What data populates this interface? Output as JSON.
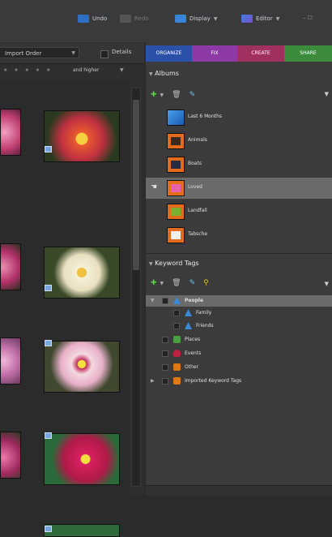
{
  "toolbar": {
    "undo_label": "Undo",
    "redo_label": "Redo",
    "display_label": "Display",
    "editor_label": "Editor",
    "edge_glyph": "– ☐"
  },
  "sort": {
    "selected": "Import Order",
    "details_label": "Details"
  },
  "rating": {
    "stars": "★ ★ ★ ★ ★",
    "and_higher": "and higher"
  },
  "tabs": [
    {
      "label": "ORGANIZE",
      "color": "#2b50a8"
    },
    {
      "label": "FIX",
      "color": "#8d39a6"
    },
    {
      "label": "CREATE",
      "color": "#a03060"
    },
    {
      "label": "SHARE",
      "color": "#3c8b3c"
    }
  ],
  "albums": {
    "title": "Albums",
    "items": [
      {
        "label": "Last 6 Months",
        "color": "#2a7fd6"
      },
      {
        "label": "Animals",
        "color": "#e36b1c"
      },
      {
        "label": "Boats",
        "color": "#e36b1c"
      },
      {
        "label": "Loved",
        "color": "#e36b1c"
      },
      {
        "label": "Landfall",
        "color": "#e36b1c"
      },
      {
        "label": "Tabsche",
        "color": "#e36b1c"
      }
    ]
  },
  "keywords": {
    "title": "Keyword Tags",
    "items": [
      {
        "label": "People",
        "level": 0,
        "color": "#3a8ad6"
      },
      {
        "label": "Family",
        "level": 1,
        "color": "#3a8ad6"
      },
      {
        "label": "Friends",
        "level": 1,
        "color": "#3a8ad6"
      },
      {
        "label": "Places",
        "level": 0,
        "color": "#4aa040"
      },
      {
        "label": "Events",
        "level": 0,
        "color": "#c02040"
      },
      {
        "label": "Other",
        "level": 0,
        "color": "#e07a10"
      },
      {
        "label": "Imported Keyword Tags",
        "level": 0,
        "color": "#e07a10"
      }
    ]
  },
  "colors": {
    "accent": "#2b50a8",
    "selected_row": "#6a6a6a"
  }
}
